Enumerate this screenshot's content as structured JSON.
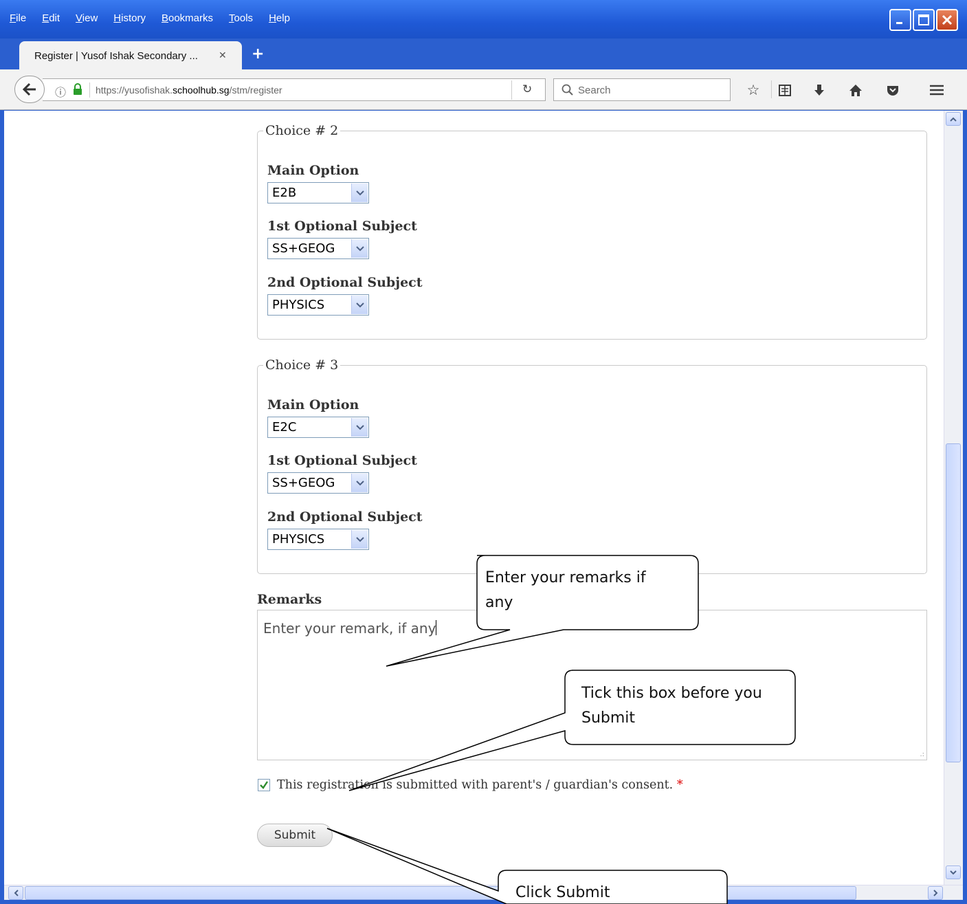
{
  "browser": {
    "menu": [
      "File",
      "Edit",
      "View",
      "History",
      "Bookmarks",
      "Tools",
      "Help"
    ],
    "tab_title": "Register | Yusof Ishak Secondary ...",
    "url_prefix": "https://yusofishak.",
    "url_domain": "schoolhub.sg",
    "url_path": "/stm/register",
    "search_placeholder": "Search"
  },
  "form": {
    "choice2": {
      "legend": "Choice # 2",
      "main_label": "Main Option",
      "main_value": "E2B",
      "opt1_label": "1st Optional Subject",
      "opt1_value": "SS+GEOG",
      "opt2_label": "2nd Optional Subject",
      "opt2_value": "PHYSICS"
    },
    "choice3": {
      "legend": "Choice # 3",
      "main_label": "Main Option",
      "main_value": "E2C",
      "opt1_label": "1st Optional Subject",
      "opt1_value": "SS+GEOG",
      "opt2_label": "2nd Optional Subject",
      "opt2_value": "PHYSICS"
    },
    "remarks_label": "Remarks",
    "remarks_value": "Enter your remark, if any",
    "consent_label": "This registration is submitted with parent's / guardian's consent.",
    "consent_required": "*",
    "consent_checked": true,
    "submit_label": "Submit"
  },
  "callouts": {
    "remarks": [
      "Enter your remarks if",
      "any"
    ],
    "tick": [
      "Tick this box before you",
      "Submit"
    ],
    "submit": "Click Submit"
  },
  "colors": {
    "chrome_blue": "#2b5fcf",
    "required_red": "#dd0000",
    "checkbox_green": "#2e8b2e"
  }
}
